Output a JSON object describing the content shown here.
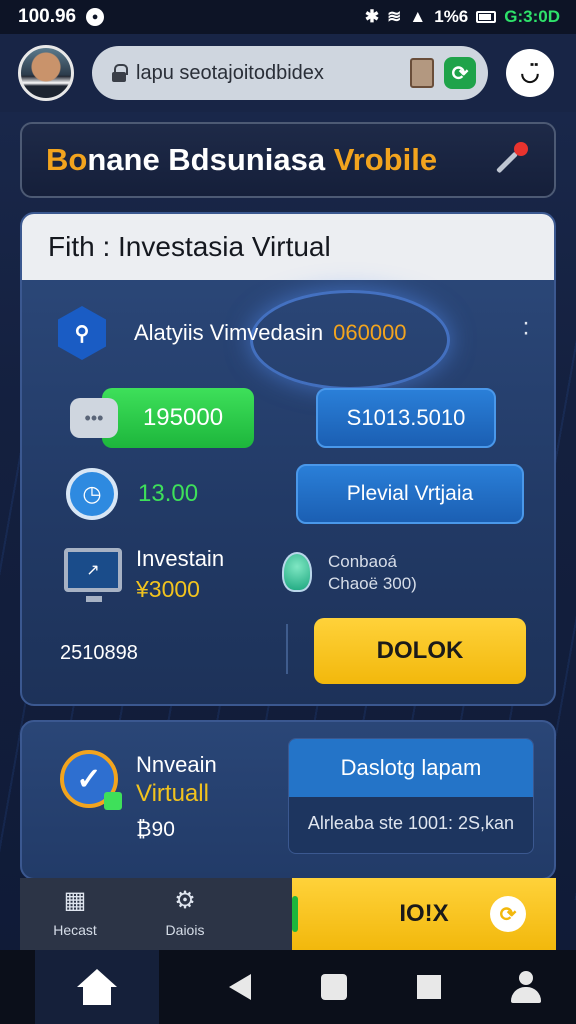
{
  "status_bar": {
    "time_left": "100.96",
    "signal_text": "1%6",
    "time_right": "G:3:0D"
  },
  "browser": {
    "url": "lapu seotajoitodbidex",
    "ext_glyph": "⟳"
  },
  "banner": {
    "title_part1": "Bo",
    "title_part2": "nane Bdsuniasa",
    "title_part3": " Vrobile"
  },
  "main_card": {
    "header": "Fith : Investasia Virtual",
    "row1_label": "Alatyiis Vimvedasin",
    "row1_value": "060000",
    "green_button": "195000",
    "blue_button_1": "S1013.5010",
    "clock_value": "13.00",
    "blue_button_2": "Plevial Vrtjaia",
    "invest_label": "Investain",
    "invest_amount": "¥3000",
    "note_line1": "Conbaoá",
    "note_line2": "Chaoë 300)",
    "code": "2510898",
    "yellow_button": "DOLOK"
  },
  "lower_card": {
    "title1": "Nnveain",
    "title2": "Virtuall",
    "amount": "₿90",
    "panel_head": "Daslotg lapam",
    "panel_body": "Alrleaba ste 1001: 2S,kan"
  },
  "app_bottom": {
    "item1_label": "Hecast",
    "item2_label": "Daiois",
    "yellow_label": "IO!X",
    "yellow_badge_glyph": "⟳"
  },
  "colors": {
    "accent_orange": "#f2a41e",
    "accent_green": "#3ee05a",
    "accent_blue": "#2474c8",
    "accent_yellow": "#ffd23a",
    "card_bg": "#2d4a7c"
  },
  "icons": {
    "status": [
      "wifi-icon",
      "signal-icon",
      "battery-icon"
    ],
    "browser": [
      "lock-icon",
      "tabs-icon",
      "extension-icon",
      "menu-face-icon"
    ],
    "nav": [
      "home-icon",
      "back-icon",
      "square-icon",
      "recents-icon",
      "person-icon"
    ]
  }
}
